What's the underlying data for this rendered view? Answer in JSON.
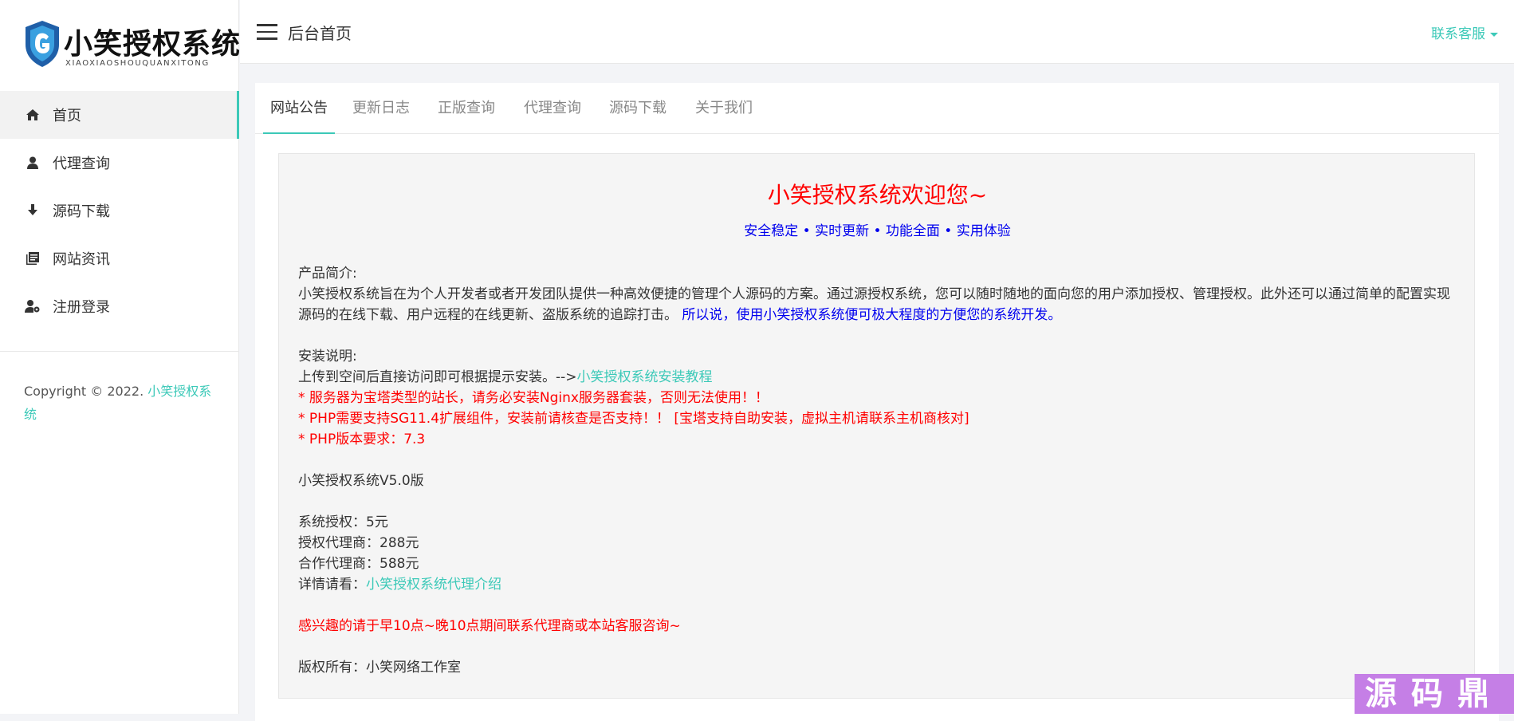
{
  "brand": {
    "name": "小笑授权系统",
    "sub": "XIAOXIAOSHOUQUANXITONG"
  },
  "sidebar": {
    "items": [
      {
        "label": "首页",
        "icon": "home-icon"
      },
      {
        "label": "代理查询",
        "icon": "user-icon"
      },
      {
        "label": "源码下载",
        "icon": "download-icon"
      },
      {
        "label": "网站资讯",
        "icon": "news-icon"
      },
      {
        "label": "注册登录",
        "icon": "user-settings-icon"
      }
    ],
    "copyright_prefix": "Copyright © 2022. ",
    "copyright_link": "小笑授权系统"
  },
  "header": {
    "title": "后台首页",
    "contact": "联系客服"
  },
  "tabs": [
    "网站公告",
    "更新日志",
    "正版查询",
    "代理查询",
    "源码下载",
    "关于我们"
  ],
  "notice": {
    "title": "小笑授权系统欢迎您~",
    "subtitle": "安全稳定 • 实时更新 • 功能全面 • 实用体验",
    "intro_heading": "产品简介:",
    "intro_text": "小笑授权系统旨在为个人开发者或者开发团队提供一种高效便捷的管理个人源码的方案。通过源授权系统，您可以随时随地的面向您的用户添加授权、管理授权。此外还可以通过简单的配置实现源码的在线下载、用户远程的在线更新、盗版系统的追踪打击。",
    "intro_highlight": "所以说，使用小笑授权系统便可极大程度的方便您的系统开发。",
    "install_heading": "安装说明:",
    "install_text": "上传到空间后直接访问即可根据提示安装。-->",
    "install_link": "小笑授权系统安装教程",
    "warn1": "* 服务器为宝塔类型的站长，请务必安装Nginx服务器套装，否则无法使用！！",
    "warn2": "* PHP需要支持SG11.4扩展组件，安装前请核查是否支持！！ [宝塔支持自助安装，虚拟主机请联系主机商核对]",
    "warn3": "* PHP版本要求：7.3",
    "version": "小笑授权系统V5.0版",
    "price1": "系统授权：5元",
    "price2": "授权代理商：288元",
    "price3": "合作代理商：588元",
    "detail_prefix": "详情请看：",
    "detail_link": "小笑授权系统代理介绍",
    "contact_note": "感兴趣的请于早10点~晚10点期间联系代理商或本站客服咨询~",
    "rights": "版权所有：小笑网络工作室"
  },
  "watermark": "源码鼎",
  "colors": {
    "accent": "#3cc9b8",
    "title_red": "#ff0000",
    "highlight_blue": "#0000ee"
  }
}
